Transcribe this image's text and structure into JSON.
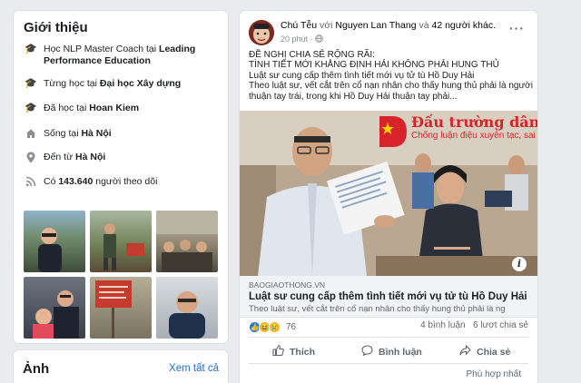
{
  "intro": {
    "title": "Giới thiệu",
    "rows": [
      {
        "icon": "graduation-cap-icon",
        "prefix": "Học NLP Master Coach tại ",
        "bold": "Leading Performance Education"
      },
      {
        "icon": "graduation-cap-icon",
        "prefix": "Từng học tại ",
        "bold": "Đại học Xây dựng"
      },
      {
        "icon": "graduation-cap-icon",
        "prefix": "Đã học tại ",
        "bold": "Hoan Kiem"
      },
      {
        "icon": "home-icon",
        "prefix": "Sống tại ",
        "bold": "Hà Nội"
      },
      {
        "icon": "location-pin-icon",
        "prefix": "Đến từ ",
        "bold": "Hà Nội"
      },
      {
        "icon": "rss-icon",
        "prefix": "Có ",
        "bold": "143.640",
        "suffix": " người theo dõi"
      }
    ]
  },
  "photos_card": {
    "title": "Ảnh",
    "see_all": "Xem tất cả"
  },
  "post": {
    "author": "Chú Tễu",
    "with_word": "với",
    "tagged": "Nguyen Lan Thang",
    "and_word": "và",
    "others": "42 người khác.",
    "time": "20 phút",
    "privacy_icon": "globe-icon",
    "more_icon": "more-options-icon",
    "text_lines": [
      "ĐỀ NGHỊ CHIA SẺ RỘNG RÃI:",
      "TÌNH TIẾT MỚI KHẲNG ĐỊNH HẢI KHÔNG PHẢI HUNG THỦ",
      "Luật sư cung cấp thêm tình tiết mới vụ tử tù Hồ Duy Hải",
      "Theo luật sư, vết cắt trên cổ nạn nhân cho thấy hung thủ phải là người",
      "thuận tay trái, trong khi Hồ Duy Hải thuận tay phải..."
    ],
    "watermark_title": "Đấu trường dân chủ",
    "watermark_sub": "Chống luận điệu xuyên tạc, sai trái",
    "link": {
      "domain": "BAOGIAOTHONG.VN",
      "title": "Luật sư cung cấp thêm tình tiết mới vụ tử tù Hồ Duy Hải",
      "desc": "Theo luật sư, vết cắt trên cổ nạn nhân cho thấy hung thủ phải là ng"
    },
    "reaction_count": "76",
    "comments": "4 bình luận",
    "shares": "6 lượt chia sẻ",
    "actions": {
      "like": "Thích",
      "comment": "Bình luận",
      "share": "Chia sẻ"
    },
    "sort": "Phù hợp nhất"
  },
  "colors": {
    "link_blue": "#216fdb",
    "like_blue": "#1877f2",
    "haha_yellow": "#f7b125",
    "watermark_red": "#d9232a"
  }
}
